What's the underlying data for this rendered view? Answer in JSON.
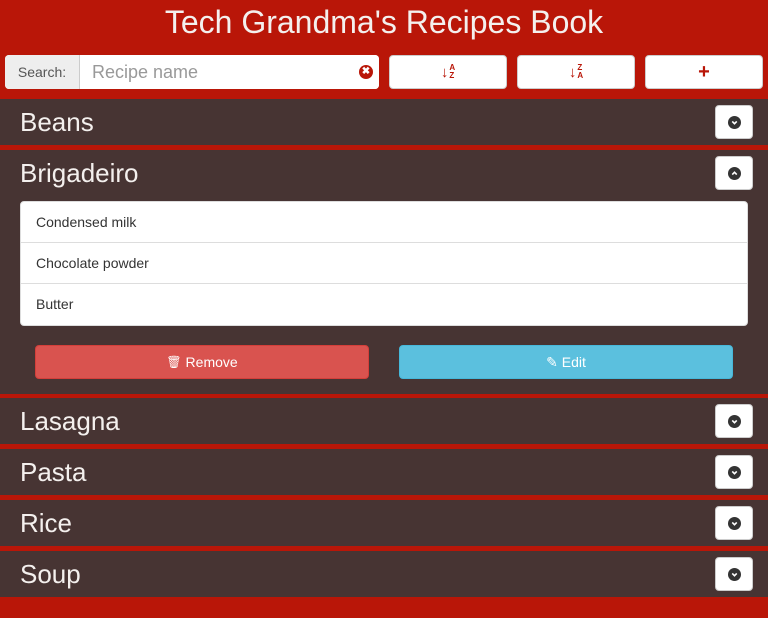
{
  "app": {
    "title": "Tech Grandma's Recipes Book"
  },
  "toolbar": {
    "search_label": "Search:",
    "search_placeholder": "Recipe name",
    "search_value": "",
    "clear_glyph": "✖",
    "sort_asc": {
      "icon": "sort-alpha-asc-icon",
      "top": "A",
      "bottom": "Z"
    },
    "sort_desc": {
      "icon": "sort-alpha-desc-icon",
      "top": "Z",
      "bottom": "A"
    },
    "add_glyph": "+",
    "arrow_glyph": "↓"
  },
  "recipes": [
    {
      "name": "Beans",
      "expanded": false
    },
    {
      "name": "Brigadeiro",
      "expanded": true,
      "ingredients": [
        "Condensed milk",
        "Chocolate powder",
        "Butter"
      ],
      "remove_label": "Remove",
      "edit_label": "Edit",
      "remove_icon_glyph": "🗑",
      "edit_icon_glyph": "✎"
    },
    {
      "name": "Lasagna",
      "expanded": false
    },
    {
      "name": "Pasta",
      "expanded": false
    },
    {
      "name": "Rice",
      "expanded": false
    },
    {
      "name": "Soup",
      "expanded": false
    }
  ],
  "colors": {
    "header_bg": "#b91608",
    "row_bg": "#473433",
    "remove": "#d9534f",
    "edit": "#5bc0de"
  }
}
